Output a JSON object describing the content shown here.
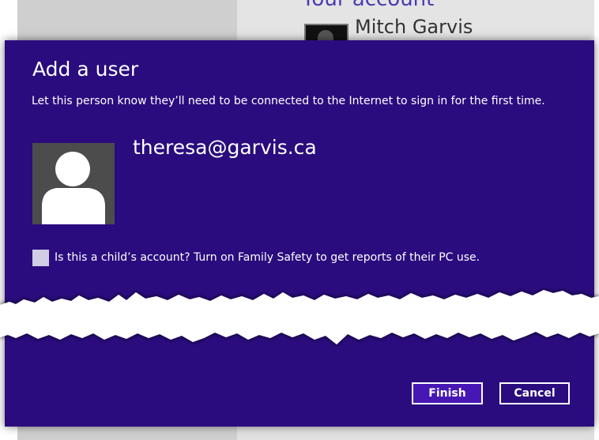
{
  "background_page": {
    "section_title": "Your account",
    "account_name": "Mitch Garvis"
  },
  "dialog": {
    "title": "Add a user",
    "description": "Let this person know they’ll need to be connected to the Internet to sign in for the first time.",
    "email": "theresa@garvis.ca",
    "child_account_checkbox": {
      "label": "Is this a child’s account? Turn on Family Safety to get reports of their PC use.",
      "checked": false
    },
    "buttons": {
      "finish": "Finish",
      "cancel": "Cancel"
    }
  },
  "colors": {
    "dialog_background": "#2a0c7e",
    "finish_button": "#4617b4",
    "text": "#ffffff"
  }
}
